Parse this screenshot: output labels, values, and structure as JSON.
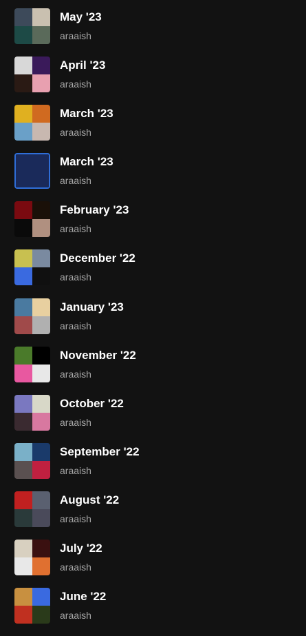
{
  "playlists": [
    {
      "title": "May '23",
      "owner": "araaish",
      "tiles": [
        "#3d4a5a",
        "#c9c0b0",
        "#1d4a46",
        "#5a6a5a"
      ]
    },
    {
      "title": "April '23",
      "owner": "araaish",
      "tiles": [
        "#d8d8d8",
        "#3a1a5a",
        "#2a1a14",
        "#e8a0b0"
      ]
    },
    {
      "title": "March '23",
      "owner": "araaish",
      "tiles": [
        "#e0b020",
        "#d06a20",
        "#6aa0c8",
        "#c8b8b0"
      ]
    },
    {
      "title": "March '23",
      "owner": "araaish",
      "single": "#1a2a5a"
    },
    {
      "title": "February '23",
      "owner": "araaish",
      "tiles": [
        "#7a0a10",
        "#1a1008",
        "#0a0a0a",
        "#b09080"
      ]
    },
    {
      "title": "December '22",
      "owner": "araaish",
      "tiles": [
        "#c8c050",
        "#7a8aa0",
        "#3a6ae0",
        "#101010"
      ]
    },
    {
      "title": "January '23",
      "owner": "araaish",
      "tiles": [
        "#4a7aa0",
        "#e8d0a0",
        "#a04a4a",
        "#b0b0b0"
      ]
    },
    {
      "title": "November '22",
      "owner": "araaish",
      "tiles": [
        "#4a7a2a",
        "#000000",
        "#e858a0",
        "#e8e8e8"
      ]
    },
    {
      "title": "October '22",
      "owner": "araaish",
      "tiles": [
        "#7a78c0",
        "#d8d8c8",
        "#3a2a30",
        "#d878a0"
      ]
    },
    {
      "title": "September '22",
      "owner": "araaish",
      "tiles": [
        "#7ab0c8",
        "#1a3a6a",
        "#5a5050",
        "#c02040"
      ]
    },
    {
      "title": "August '22",
      "owner": "araaish",
      "tiles": [
        "#c02020",
        "#5a6070",
        "#2a3a3a",
        "#4a4a5a"
      ]
    },
    {
      "title": "July '22",
      "owner": "araaish",
      "tiles": [
        "#d8d0c0",
        "#3a1010",
        "#e8e8e8",
        "#e07030"
      ]
    },
    {
      "title": "June '22",
      "owner": "araaish",
      "tiles": [
        "#c89040",
        "#3a6ae0",
        "#c03020",
        "#2a3a1a"
      ]
    }
  ]
}
